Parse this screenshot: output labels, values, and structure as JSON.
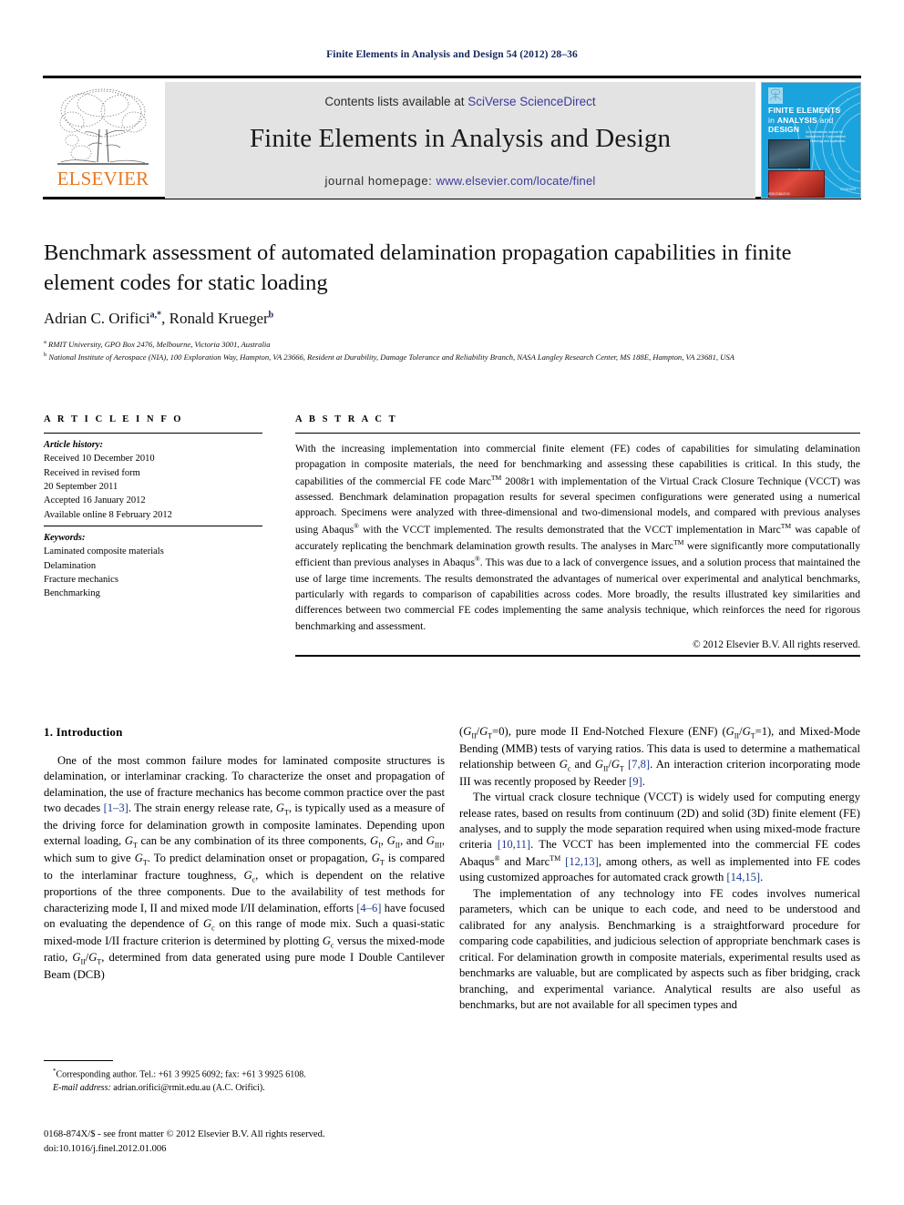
{
  "running_head": "Finite Elements in Analysis and Design 54 (2012) 28–36",
  "masthead": {
    "publisher_name": "ELSEVIER",
    "contents_prefix": "Contents lists available at ",
    "contents_link": "SciVerse ScienceDirect",
    "journal_title": "Finite Elements in Analysis and Design",
    "homepage_prefix": "journal homepage: ",
    "homepage_link": "www.elsevier.com/locate/finel",
    "cover": {
      "line1": "FINITE ELEMENTS",
      "line2_a": "in ",
      "line2_b": "ANALYSIS",
      "line2_c": " and",
      "line3": "DESIGN",
      "subtitle": "An International Journal for Innovations in Computational Methodology and Application",
      "brand": "ELSEVIER",
      "foot": "ISSN 0168-874X"
    }
  },
  "article": {
    "title": "Benchmark assessment of automated delamination propagation capabilities in finite element codes for static loading",
    "authors": "Adrian C. Orifici, Ronald Krueger",
    "author1": "Adrian C. Orifici",
    "author1_sup": "a,*",
    "author2": "Ronald Krueger",
    "author2_sup": "b",
    "affiliation_a_sup": "a",
    "affiliation_a": "RMIT University, GPO Box 2476, Melbourne, Victoria 3001, Australia",
    "affiliation_b_sup": "b",
    "affiliation_b": "National Institute of Aerospace (NIA), 100 Exploration Way, Hampton, VA 23666, Resident at Durability, Damage Tolerance and Reliability Branch, NASA Langley Research Center, MS 188E, Hampton, VA 23681, USA"
  },
  "article_info": {
    "heading": "A R T I C L E   I N F O",
    "history_label": "Article history:",
    "history": [
      "Received 10 December 2010",
      "Received in revised form",
      "20 September 2011",
      "Accepted 16 January 2012",
      "Available online 8 February 2012"
    ],
    "keywords_label": "Keywords:",
    "keywords": [
      "Laminated composite materials",
      "Delamination",
      "Fracture mechanics",
      "Benchmarking"
    ]
  },
  "abstract": {
    "heading": "A B S T R A C T",
    "para_1": "With the increasing implementation into commercial finite element (FE) codes of capabilities for simulating delamination propagation in composite materials, the need for benchmarking and assessing these capabilities is critical. In this study, the capabilities of the commercial FE code Marc",
    "para_1_sup": "TM",
    "para_2": " 2008r1 with implementation of the Virtual Crack Closure Technique (VCCT) was assessed. Benchmark delamination propagation results for several specimen configurations were generated using a numerical approach. Specimens were analyzed with three-dimensional and two-dimensional models, and compared with previous analyses using Abaqus",
    "para_2_sup": "®",
    "para_3": " with the VCCT implemented. The results demonstrated that the VCCT implementation in Marc",
    "para_3_sup": "TM",
    "para_4": " was capable of accurately replicating the benchmark delamination growth results. The analyses in Marc",
    "para_4_sup": "TM",
    "para_5": " were significantly more computationally efficient than previous analyses in Abaqus",
    "para_5_sup": "®",
    "para_6": ". This was due to a lack of convergence issues, and a solution process that maintained the use of large time increments. The results demonstrated the advantages of numerical over experimental and analytical benchmarks, particularly with regards to comparison of capabilities across codes. More broadly, the results illustrated key similarities and differences between two commercial FE codes implementing the same analysis technique, which reinforces the need for rigorous benchmarking and assessment.",
    "copyright": "© 2012 Elsevier B.V. All rights reserved."
  },
  "body": {
    "section_heading": "1.  Introduction",
    "left": {
      "p1_a": "One of the most common failure modes for laminated composite structures is delamination, or interlaminar cracking. To characterize the onset and propagation of delamination, the use of fracture mechanics has become common practice over the past two decades ",
      "p1_ref1": "[1–3]",
      "p1_b": ". The strain energy release rate, ",
      "p1_gt1": "G",
      "p1_gt1_sub": "T",
      "p1_c": ", is typically used as a measure of the driving force for delamination growth in composite laminates. Depending upon external loading, ",
      "p1_gt2": "G",
      "p1_gt2_sub": "T",
      "p1_d": " can be any combination of its three components, ",
      "p1_gi": "G",
      "p1_gi_sub": "I",
      "p1_gii": "G",
      "p1_gii_sub": "II",
      "p1_giii": "G",
      "p1_giii_sub": "III",
      "p1_e": ", and ",
      "p1_f": ", which sum to give ",
      "p1_gt3": "G",
      "p1_gt3_sub": "T",
      "p1_g": ". To predict delamination onset or propagation, ",
      "p1_gt4": "G",
      "p1_gt4_sub": "T",
      "p1_h": " is compared to the interlaminar fracture toughness, ",
      "p1_gc1": "G",
      "p1_gc1_sub": "c",
      "p1_i": ", which is dependent on the relative proportions of the three components. Due to the availability of test methods for characterizing mode I, II and mixed mode I/II delamination, efforts ",
      "p1_ref2": "[4–6]",
      "p1_j": " have focused on evaluating the dependence of ",
      "p1_gc2": "G",
      "p1_gc2_sub": "c",
      "p1_k": " on this range of mode mix. Such a quasi-static mixed-mode I/II fracture criterion is determined by plotting ",
      "p1_gc3": "G",
      "p1_gc3_sub": "c",
      "p1_l": " versus the mixed-mode ratio, ",
      "p1_gii2": "G",
      "p1_gii2_sub": "II",
      "p1_slash": "/",
      "p1_gt5": "G",
      "p1_gt5_sub": "T",
      "p1_m": ", determined from data generated using pure mode I Double Cantilever Beam (DCB)"
    },
    "right": {
      "p1_a": "(",
      "p1_gii_a": "G",
      "p1_gii_a_sub": "II",
      "p1_gt_a": "G",
      "p1_gt_a_sub": "T",
      "p1_b": "=0), pure mode II End-Notched Flexure (ENF) (",
      "p1_gii_b": "G",
      "p1_gii_b_sub": "II",
      "p1_gt_b": "G",
      "p1_gt_b_sub": "T",
      "p1_c": "=1), and Mixed-Mode Bending (MMB) tests of varying ratios. This data is used to determine a mathematical relationship between ",
      "p1_gc": "G",
      "p1_gc_sub": "c",
      "p1_d": " and ",
      "p1_gii_c": "G",
      "p1_gii_c_sub": "II",
      "p1_gt_c": "G",
      "p1_gt_c_sub": "T",
      "p1_e": " ",
      "p1_ref1": "[7,8]",
      "p1_f": ". An interaction criterion incorporating mode III was recently proposed by Reeder ",
      "p1_ref2": "[9]",
      "p1_g": ".",
      "p2_a": "The virtual crack closure technique (VCCT) is widely used for computing energy release rates, based on results from continuum (2D) and solid (3D) finite element (FE) analyses, and to supply the mode separation required when using mixed-mode fracture criteria ",
      "p2_ref1": "[10,11]",
      "p2_b": ". The VCCT has been implemented into the commercial FE codes Abaqus",
      "p2_sup1": "®",
      "p2_c": " and Marc",
      "p2_sup2": "TM",
      "p2_d": " ",
      "p2_ref2": "[12,13]",
      "p2_e": ", among others, as well as implemented into FE codes using customized approaches for automated crack growth ",
      "p2_ref3": "[14,15]",
      "p2_f": ".",
      "p3": "The implementation of any technology into FE codes involves numerical parameters, which can be unique to each code, and need to be understood and calibrated for any analysis. Benchmarking is a straightforward procedure for comparing code capabilities, and judicious selection of appropriate benchmark cases is critical. For delamination growth in composite materials, experimental results used as benchmarks are valuable, but are complicated by aspects such as fiber bridging, crack branching, and experimental variance. Analytical results are also useful as benchmarks, but are not available for all specimen types and"
    }
  },
  "footnotes": {
    "corresponding_sup": "*",
    "corresponding": "Corresponding author. Tel.: +61 3 9925 6092; fax: +61 3 9925 6108.",
    "email_label": "E-mail address:",
    "email": " adrian.orifici@rmit.edu.au (A.C. Orifici)."
  },
  "imprint": {
    "line1": "0168-874X/$ - see front matter © 2012 Elsevier B.V. All rights reserved.",
    "line2": "doi:10.1016/j.finel.2012.01.006"
  },
  "colors": {
    "link": "#3b3b9e",
    "running_head": "#13265c",
    "reference": "#1b3a8f",
    "elsevier_orange": "#e87722",
    "masthead_bg": "#e3e3e3",
    "cover_blue": "#1ba3dd"
  }
}
